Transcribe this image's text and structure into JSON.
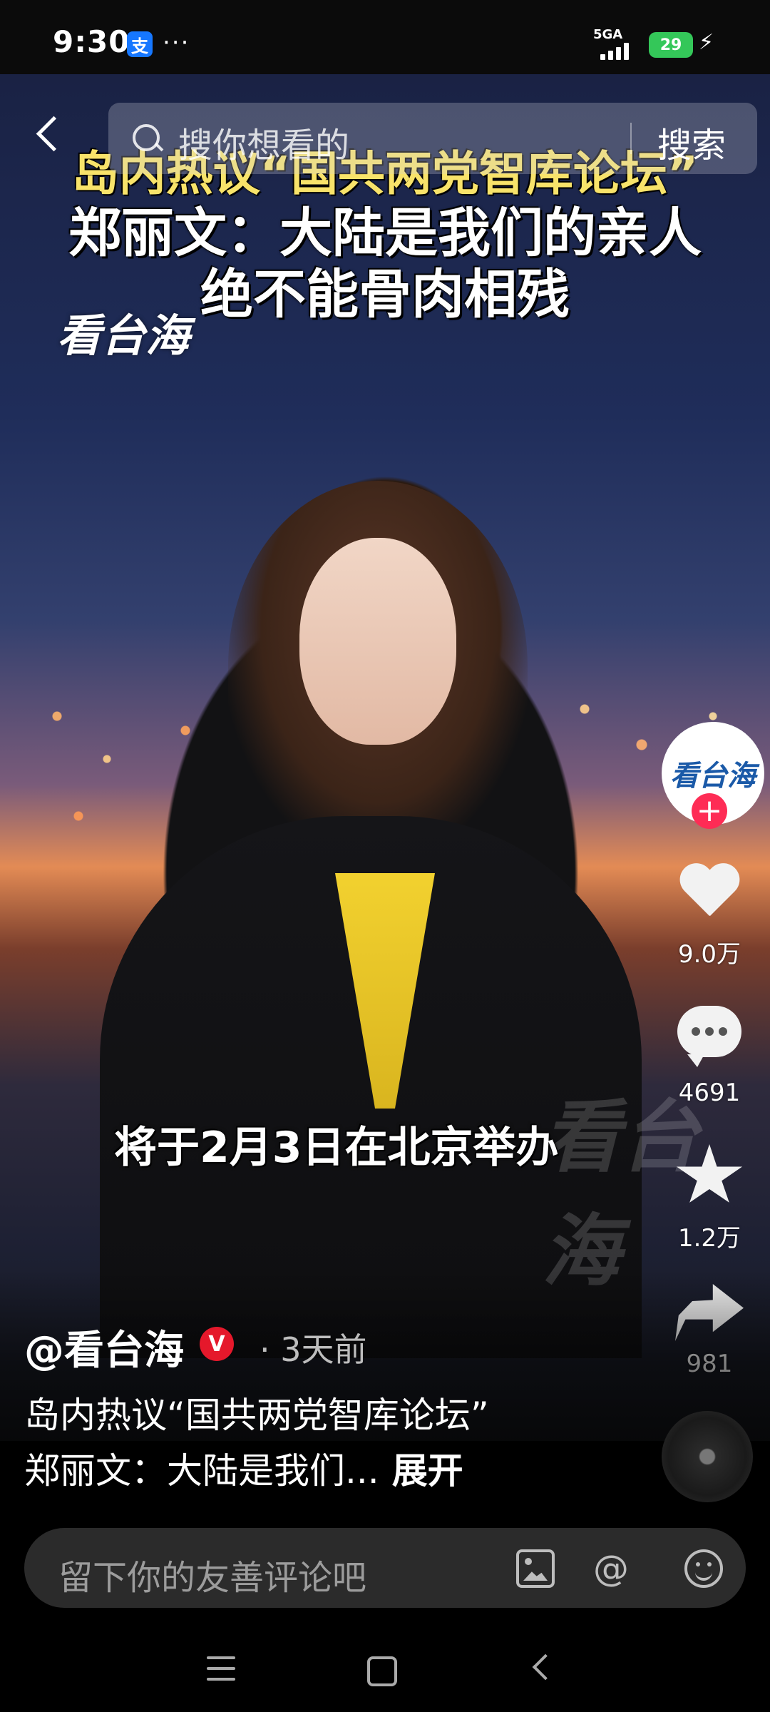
{
  "status_bar": {
    "time": "9:30",
    "alipay_glyph": "支",
    "more": "···",
    "network": "5GA",
    "battery": "29"
  },
  "search": {
    "placeholder": "搜你想看的",
    "button": "搜索"
  },
  "video": {
    "headline_line1": "岛内热议“国共两党智库论坛”",
    "headline_line2": "郑丽文：大陆是我们的亲人",
    "headline_line3": "绝不能骨肉相残",
    "channel_logo": "看台海",
    "subtitle": "将于2月3日在北京举办",
    "watermark": "看台海"
  },
  "side_actions": {
    "avatar_text": "看台海",
    "follow_plus": "+",
    "likes": "9.0万",
    "comments": "4691",
    "favorites": "1.2万",
    "shares": "981"
  },
  "info": {
    "author": "@看台海",
    "verified_badge": "V",
    "posted": "· 3天前",
    "desc_line1": "岛内热议“国共两党智库论坛”",
    "desc_line2": "郑丽文：大陆是我们...",
    "expand": "展开"
  },
  "comment_bar": {
    "placeholder": "留下你的友善评论吧",
    "at_symbol": "@"
  },
  "colors": {
    "accent_red": "#fe2c55",
    "headline_yellow": "#f8e36a",
    "battery_green": "#34c759"
  }
}
